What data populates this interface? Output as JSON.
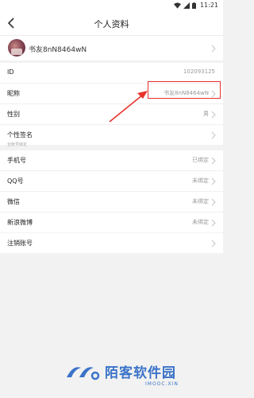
{
  "status_bar": {
    "time": "11:21"
  },
  "header": {
    "title": "个人资料"
  },
  "profile": {
    "username": "书友8nN8464wN"
  },
  "account_info": [
    {
      "label": "ID",
      "value": "102093125"
    },
    {
      "label": "昵称",
      "value": "书友8nN8464wN"
    },
    {
      "label": "性别",
      "value": "男"
    },
    {
      "label": "个性签名",
      "value": ""
    }
  ],
  "section_caption": "全帐号绑定",
  "bindings": [
    {
      "label": "手机号",
      "value": "已绑定"
    },
    {
      "label": "QQ号",
      "value": "未绑定"
    },
    {
      "label": "微信",
      "value": "未绑定"
    },
    {
      "label": "新浪微博",
      "value": "未绑定"
    }
  ],
  "deregister": {
    "label": "注销账号"
  },
  "watermark": {
    "title": "陌客软件园",
    "subtitle": "IMOOC.XIN"
  },
  "colors": {
    "annotation": "#e8322b",
    "watermark": "#3b73c8"
  }
}
